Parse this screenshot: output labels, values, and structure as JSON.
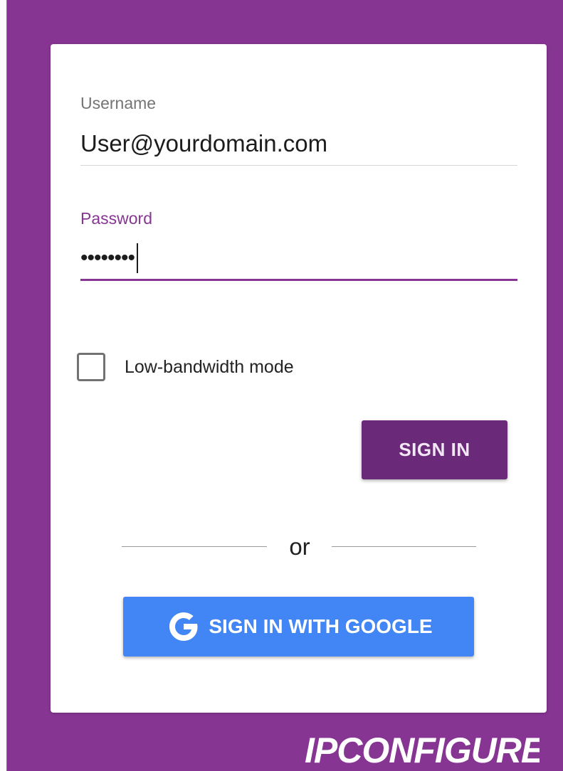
{
  "form": {
    "username": {
      "label": "Username",
      "value": "User@yourdomain.com"
    },
    "password": {
      "label": "Password",
      "masked_value": "••••••••"
    },
    "low_bandwidth": {
      "label": "Low-bandwidth mode",
      "checked": false
    },
    "sign_in_label": "SIGN IN",
    "divider_text": "or",
    "google_sign_in_label": "SIGN IN WITH GOOGLE"
  },
  "brand": {
    "logo_text": "IPCONFIGURE"
  },
  "colors": {
    "brand_purple": "#873593",
    "button_purple": "#6b2a79",
    "google_blue": "#4285f4"
  },
  "icons": {
    "google": "google-g-icon",
    "checkbox": "checkbox-unchecked-icon"
  }
}
